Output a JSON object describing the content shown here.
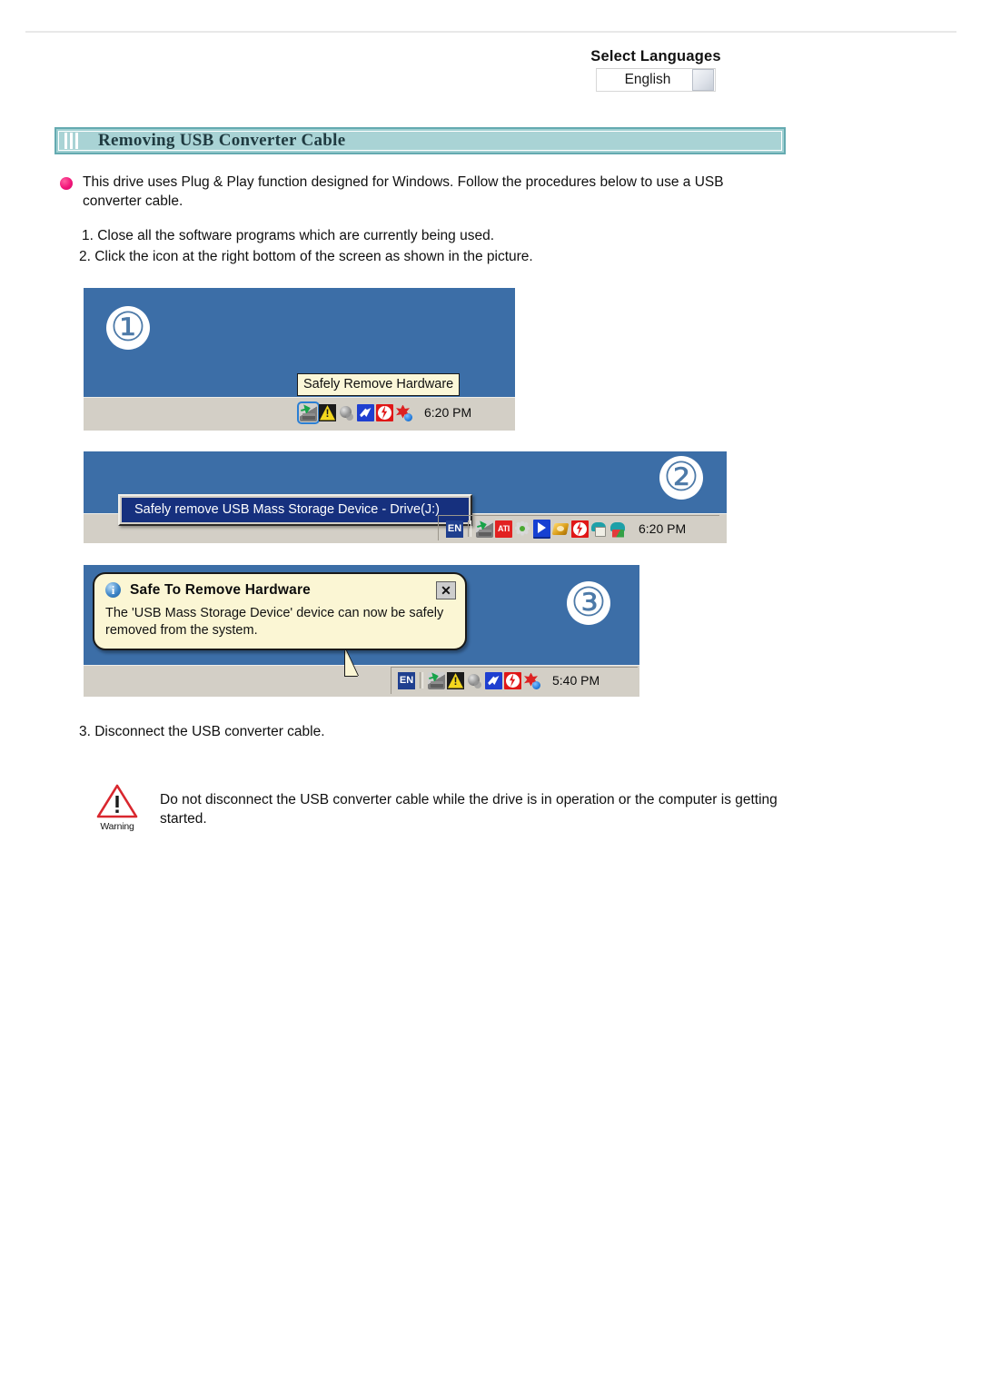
{
  "language_selector": {
    "title": "Select Languages",
    "selected": "English",
    "dropdown_icon": "dropdown-arrow-icon"
  },
  "section": {
    "title": "Removing USB Converter Cable"
  },
  "intro": {
    "bullet_icon": "bullet-dot-icon",
    "text": "This drive uses Plug & Play function designed for Windows. Follow the procedures below to use a USB converter cable."
  },
  "steps": {
    "step1": "1.  Close all the software programs which are currently being used.",
    "step2": "2. Click the icon at the right bottom of the screen as shown in the picture.",
    "step3": "3. Disconnect the USB converter cable."
  },
  "figure1": {
    "step_number": "①",
    "tooltip": "Safely Remove Hardware",
    "clock": "6:20 PM",
    "tray_icons": [
      "safely-remove-hardware-icon",
      "warning-triangle-icon",
      "volume-speaker-icon",
      "network-connection-icon",
      "red-alert-icon",
      "flower-utility-icon"
    ]
  },
  "figure2": {
    "step_number": "②",
    "menu_item": "Safely remove USB Mass Storage Device - Drive(J:)",
    "clock": "6:20 PM",
    "language_indicator": "EN",
    "tray_icons": [
      "safely-remove-hardware-icon",
      "ati-graphics-icon",
      "gear-settings-icon",
      "media-play-icon",
      "gold-disc-icon",
      "red-alert-icon",
      "teal-printer-icon",
      "teal-flag-icon"
    ]
  },
  "figure3": {
    "step_number": "③",
    "balloon_title": "Safe To Remove Hardware",
    "balloon_body": "The 'USB Mass Storage Device' device can now be safely removed from the system.",
    "balloon_info_icon": "info-icon",
    "balloon_close_label": "✕",
    "clock": "5:40 PM",
    "language_indicator": "EN",
    "tray_icons": [
      "safely-remove-hardware-icon",
      "warning-triangle-icon",
      "volume-speaker-icon",
      "network-connection-icon",
      "red-alert-icon",
      "flower-utility-icon"
    ]
  },
  "warning": {
    "icon": "warning-triangle-icon",
    "label": "Warning",
    "text": "Do not disconnect the USB converter cable while the drive is in operation or the computer is getting started."
  },
  "colors": {
    "header_bg": "#a9d3d5",
    "header_border": "#64aab0",
    "desktop_blue": "#3c6ea7",
    "taskbar_gray": "#d3cfc6",
    "tooltip_yellow": "#fbf6d4",
    "menu_highlight": "#16307e",
    "bullet_pink": "#f2167a",
    "warning_red": "#d9272e"
  }
}
